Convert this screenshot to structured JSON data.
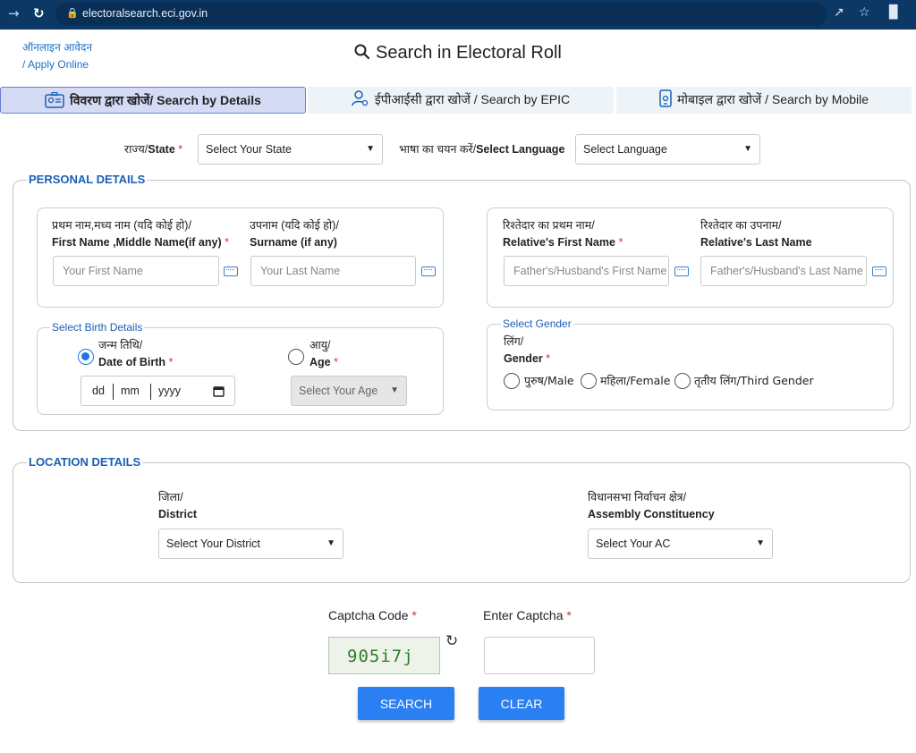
{
  "browser": {
    "url": "electoralsearch.eci.gov.in"
  },
  "header": {
    "apply_online_hindi": "ऑनलाइन आवेदन",
    "apply_online": "/ Apply Online",
    "title": "Search in Electoral Roll"
  },
  "tabs": [
    {
      "label": "विवरण द्वारा खोजें/ Search by Details"
    },
    {
      "label": "ईपीआईसी द्वारा खोजें / Search by EPIC"
    },
    {
      "label": "मोबाइल द्वारा खोजें / Search by Mobile"
    }
  ],
  "top_selects": {
    "state_label_hi": "राज्य/",
    "state_label": "State",
    "state_value": "Select Your State",
    "language_label_hi": "भाषा का चयन करें/",
    "language_label": "Select Language",
    "language_value": "Select Language"
  },
  "personal": {
    "legend": "PERSONAL DETAILS",
    "first_name_label_hi": "प्रथम नाम,मध्य नाम (यदि कोई हो)/",
    "first_name_label": "First Name ,Middle Name(if any)",
    "first_name_placeholder": "Your First Name",
    "surname_label_hi": "उपनाम (यदि कोई हो)/",
    "surname_label": "Surname (if any)",
    "surname_placeholder": "Your Last Name",
    "rel_first_label_hi": "रिश्तेदार का प्रथम नाम/",
    "rel_first_label": "Relative's First Name",
    "rel_first_placeholder": "Father's/Husband's First Name",
    "rel_last_label_hi": "रिश्तेदार का उपनाम/",
    "rel_last_label": "Relative's Last Name",
    "rel_last_placeholder": "Father's/Husband's Last Name",
    "birth_legend": "Select Birth Details",
    "dob_label_hi": "जन्म तिथि/",
    "dob_label": "Date of Birth",
    "dob_dd": "dd",
    "dob_mm": "mm",
    "dob_yyyy": "yyyy",
    "age_label_hi": "आयु/",
    "age_label": "Age",
    "age_value": "Select Your Age",
    "gender_legend": "Select Gender",
    "gender_label_hi": "लिंग/",
    "gender_label": "Gender",
    "gender_options": [
      "पुरुष/Male",
      "महिला/Female",
      "तृतीय लिंग/Third Gender"
    ]
  },
  "location": {
    "legend": "LOCATION DETAILS",
    "district_label_hi": "जिला/",
    "district_label": "District",
    "district_value": "Select Your District",
    "ac_label_hi": "विधानसभा निर्वाचन क्षेत्र/",
    "ac_label": "Assembly Constituency",
    "ac_value": "Select Your AC"
  },
  "captcha": {
    "code_label": "Captcha Code",
    "enter_label": "Enter Captcha",
    "code": "905i7j"
  },
  "buttons": {
    "search": "SEARCH",
    "clear": "CLEAR"
  },
  "required_mark": "*"
}
